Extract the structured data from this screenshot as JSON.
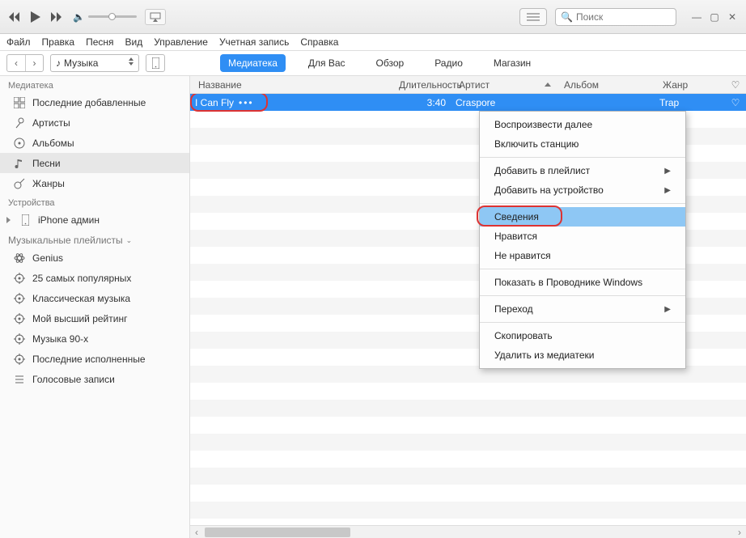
{
  "search": {
    "placeholder": "Поиск"
  },
  "menu": [
    "Файл",
    "Правка",
    "Песня",
    "Вид",
    "Управление",
    "Учетная запись",
    "Справка"
  ],
  "drop_label": "Музыка",
  "tabs": [
    "Медиатека",
    "Для Вас",
    "Обзор",
    "Радио",
    "Магазин"
  ],
  "active_tab": 0,
  "sidebar": {
    "sec1": "Медиатека",
    "lib": [
      {
        "label": "Последние добавленные",
        "icon": "grid"
      },
      {
        "label": "Артисты",
        "icon": "mic"
      },
      {
        "label": "Альбомы",
        "icon": "album"
      },
      {
        "label": "Песни",
        "icon": "note",
        "sel": true
      },
      {
        "label": "Жанры",
        "icon": "guitar"
      }
    ],
    "sec2": "Устройства",
    "device": {
      "label": "iPhone админ"
    },
    "sec3": "Музыкальные плейлисты",
    "pls": [
      {
        "label": "Genius",
        "icon": "atom"
      },
      {
        "label": "25 самых популярных",
        "icon": "gear"
      },
      {
        "label": "Классическая музыка",
        "icon": "gear"
      },
      {
        "label": "Мой высший рейтинг",
        "icon": "gear"
      },
      {
        "label": "Музыка 90-х",
        "icon": "gear"
      },
      {
        "label": "Последние исполненные",
        "icon": "gear"
      },
      {
        "label": "Голосовые записи",
        "icon": "list"
      }
    ]
  },
  "columns": {
    "name": "Название",
    "dur": "Длительность",
    "art": "Артист",
    "alb": "Альбом",
    "gen": "Жанр"
  },
  "track": {
    "name": "I Can Fly",
    "dur": "3:40",
    "art": "Craspore",
    "alb": "",
    "gen": "Trap"
  },
  "ctx": [
    {
      "label": "Воспроизвести далее"
    },
    {
      "label": "Включить станцию"
    },
    {
      "sep": true
    },
    {
      "label": "Добавить в плейлист",
      "sub": true
    },
    {
      "label": "Добавить на устройство",
      "sub": true
    },
    {
      "sep": true
    },
    {
      "label": "Сведения",
      "hi": true
    },
    {
      "label": "Нравится"
    },
    {
      "label": "Не нравится"
    },
    {
      "sep": true
    },
    {
      "label": "Показать в Проводнике Windows"
    },
    {
      "sep": true
    },
    {
      "label": "Переход",
      "sub": true
    },
    {
      "sep": true
    },
    {
      "label": "Скопировать"
    },
    {
      "label": "Удалить из медиатеки"
    }
  ]
}
